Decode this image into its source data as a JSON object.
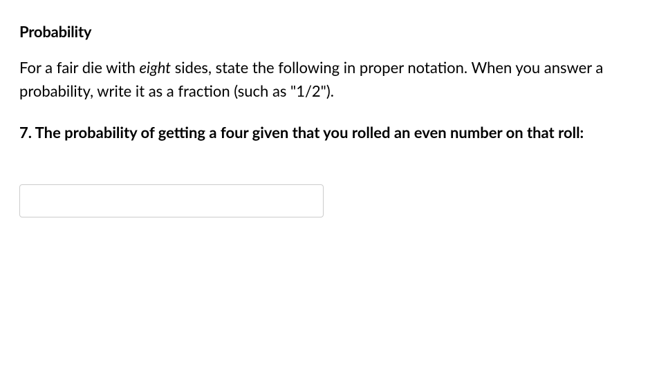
{
  "heading": "Probability",
  "instructions": {
    "part1": "For a fair die with ",
    "emphasis": "eight",
    "part2": " sides, state the following in proper notation. When you answer a probability, write it as a fraction (such as \"1/2\")."
  },
  "question": "7. The probability of getting a four given that you rolled an even number on that roll:",
  "answer": {
    "value": "",
    "placeholder": ""
  }
}
